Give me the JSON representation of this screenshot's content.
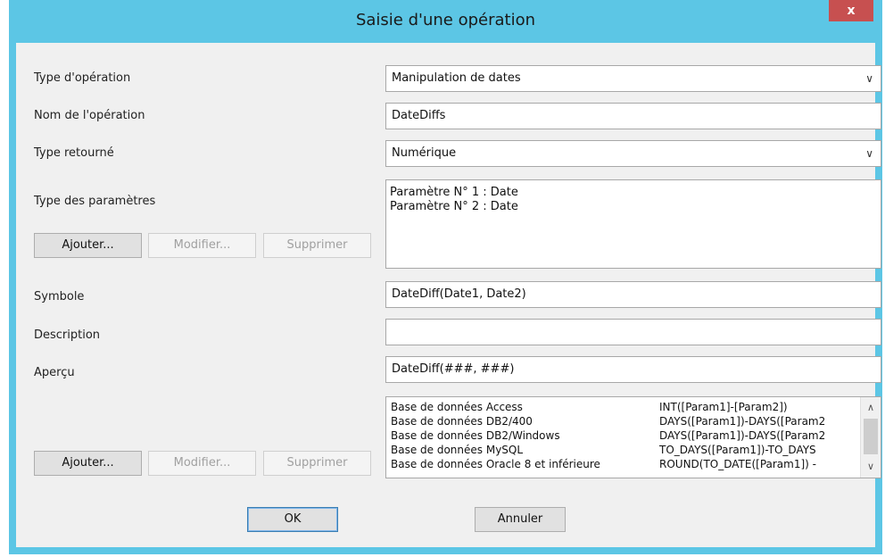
{
  "window": {
    "title": "Saisie d'une opération",
    "close_label": "x"
  },
  "form": {
    "type_operation": {
      "label": "Type d'opération",
      "value": "Manipulation de dates"
    },
    "nom_operation": {
      "label": "Nom de l'opération",
      "value": "DateDiffs"
    },
    "type_retourne": {
      "label": "Type retourné",
      "value": "Numérique"
    },
    "type_parametres": {
      "label": "Type des paramètres",
      "items": [
        "Paramètre N° 1 : Date",
        "Paramètre N° 2 : Date"
      ]
    },
    "symbole": {
      "label": "Symbole",
      "value": "DateDiff(Date1, Date2)"
    },
    "description": {
      "label": "Description",
      "value": ""
    },
    "apercu": {
      "label": "Aperçu",
      "value": "DateDiff(###, ###)"
    },
    "databases": [
      {
        "name": "Base de données Access",
        "expr": "INT([Param1]-[Param2])"
      },
      {
        "name": "Base de données DB2/400",
        "expr": "DAYS([Param1])-DAYS([Param2"
      },
      {
        "name": "Base de données DB2/Windows",
        "expr": "DAYS([Param1])-DAYS([Param2"
      },
      {
        "name": "Base de données MySQL",
        "expr": "TO_DAYS([Param1])-TO_DAYS"
      },
      {
        "name": "Base de données Oracle 8 et inférieure",
        "expr": "ROUND(TO_DATE([Param1]) - "
      }
    ]
  },
  "buttons": {
    "ajouter": "Ajouter...",
    "modifier": "Modifier...",
    "supprimer": "Supprimer",
    "ok": "OK",
    "annuler": "Annuler"
  },
  "icons": {
    "dropdown": "chevron-down-icon",
    "scroll_up": "chevron-up-icon",
    "scroll_down": "chevron-down-icon"
  }
}
